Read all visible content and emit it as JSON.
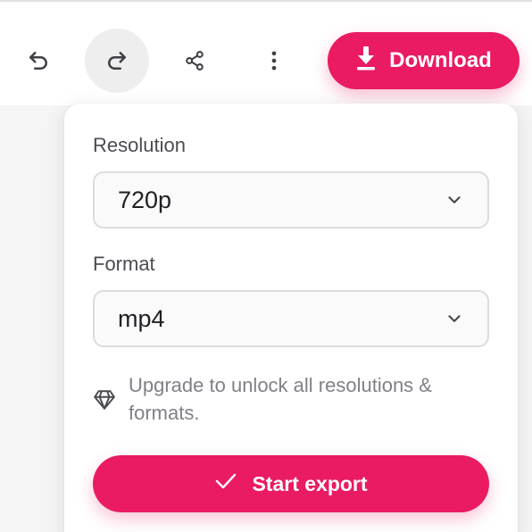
{
  "toolbar": {
    "undo_icon": "undo-icon",
    "redo_icon": "redo-icon",
    "share_icon": "share-icon",
    "more_icon": "more-vertical-icon",
    "download_label": "Download",
    "download_icon": "download-icon"
  },
  "export_panel": {
    "resolution": {
      "label": "Resolution",
      "value": "720p"
    },
    "format": {
      "label": "Format",
      "value": "mp4"
    },
    "upgrade_text": "Upgrade to unlock all resolutions & formats.",
    "upgrade_icon": "diamond-icon",
    "start_export_label": "Start export",
    "start_export_icon": "check-icon"
  },
  "colors": {
    "accent": "#ea1b63",
    "text_primary": "#1f1f24",
    "text_muted": "#808087"
  }
}
